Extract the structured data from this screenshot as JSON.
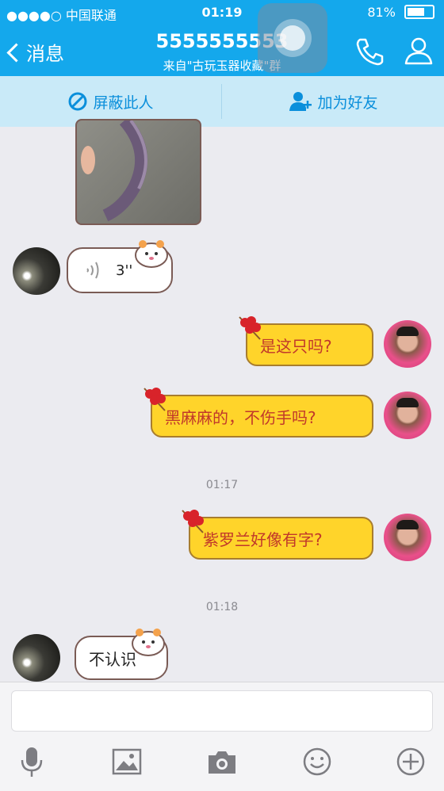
{
  "status": {
    "carrier": "●●●●○ 中国联通",
    "time": "01:19",
    "battery": "81%",
    "battery_fraction": 0.81
  },
  "nav": {
    "back_label": "消息",
    "title": "5555555553",
    "subtitle": "来自\"古玩玉器收藏\"群"
  },
  "actions": {
    "block_label": "屏蔽此人",
    "add_friend_label": "加为好友"
  },
  "messages": {
    "voice_duration": "3''",
    "m1": "是这只吗?",
    "m2": "黑麻麻的，不伤手吗?",
    "time1": "01:17",
    "m3": "紫罗兰好像有字?",
    "time2": "01:18",
    "m4": "不认识"
  },
  "input": {
    "placeholder": ""
  },
  "icons": [
    "phone-icon",
    "contact-icon",
    "block-icon",
    "add-friend-icon",
    "microphone-icon",
    "image-icon",
    "camera-icon",
    "emoji-icon",
    "plus-icon"
  ],
  "colors": {
    "header": "#14a8ec",
    "action_bar": "#c9eaf8",
    "bubble_yellow": "#ffd42a",
    "bubble_text_red": "#c1382a"
  }
}
